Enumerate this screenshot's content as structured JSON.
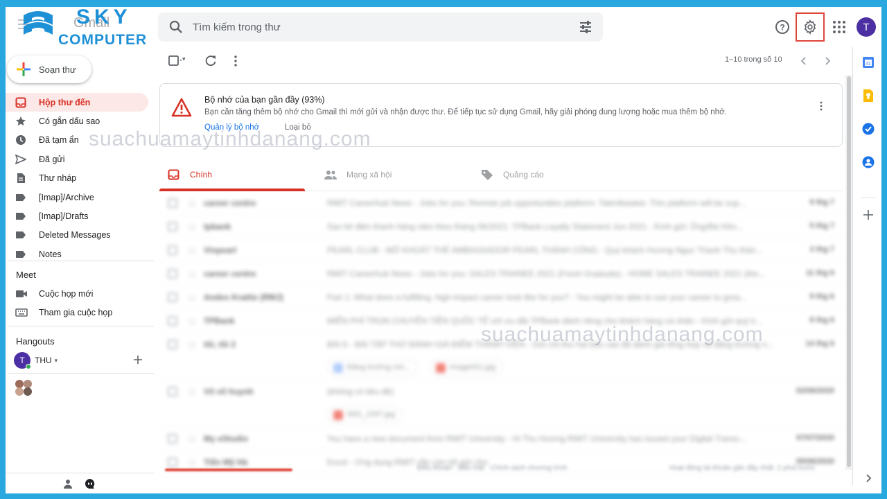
{
  "brand": {
    "logo_line1": "SKY",
    "logo_line2": "COMPUTER",
    "app_name": "Gmail"
  },
  "search": {
    "placeholder": "Tìm kiếm trong thư"
  },
  "header": {
    "avatar_initial": "T"
  },
  "compose": {
    "label": "Soạn thư"
  },
  "nav": [
    {
      "label": "Hộp thư đến",
      "icon": "inbox-icon",
      "active": true
    },
    {
      "label": "Có gắn dấu sao",
      "icon": "star-icon"
    },
    {
      "label": "Đã tạm ẩn",
      "icon": "clock-icon"
    },
    {
      "label": "Đã gửi",
      "icon": "send-icon"
    },
    {
      "label": "Thư nháp",
      "icon": "draft-icon"
    },
    {
      "label": "[Imap]/Archive",
      "icon": "label-icon"
    },
    {
      "label": "[Imap]/Drafts",
      "icon": "label-icon"
    },
    {
      "label": "Deleted Messages",
      "icon": "label-icon"
    },
    {
      "label": "Notes",
      "icon": "label-icon"
    }
  ],
  "meet": {
    "title": "Meet",
    "items": [
      {
        "label": "Cuộc họp mới",
        "icon": "video-icon"
      },
      {
        "label": "Tham gia cuộc họp",
        "icon": "keyboard-icon"
      }
    ]
  },
  "hangouts": {
    "title": "Hangouts",
    "user_name": "THU",
    "user_initial": "T"
  },
  "toolbar": {
    "pager": "1–10 trong số 10"
  },
  "alert": {
    "title": "Bộ nhớ của bạn gần đầy (93%)",
    "body": "Bạn cần tăng thêm bộ nhớ cho Gmail thì mới gửi và nhận được thư. Để tiếp tục sử dụng Gmail, hãy giải phóng dung lượng hoặc mua thêm bộ nhớ.",
    "link_manage": "Quản lý bộ nhớ",
    "link_dismiss": "Loại bỏ"
  },
  "watermark": "suachuamaytinhdanang.com",
  "tabs": [
    {
      "label": "Chính",
      "icon": "inbox-icon",
      "active": true
    },
    {
      "label": "Mạng xã hội",
      "icon": "people-icon"
    },
    {
      "label": "Quảng cáo",
      "icon": "tag-icon"
    }
  ],
  "colors": {
    "accent_red": "#d93025",
    "frame_blue": "#29a8e0",
    "link_blue": "#1a73e8"
  },
  "emails": [
    {
      "sender": "career centre",
      "subject": "RMIT Careerhub News - Jobs for you: Remote job opportunities platform: Talentbasket. This platform will be sup...",
      "date": "9 thg 7"
    },
    {
      "sender": "tpbank",
      "subject": "Sao kê điện thanh hàng năm theo tháng 06/2021: TPBank Loyalty Statement Jun 2021 - Kính gửi: Ông/Bà Hồn...",
      "date": "5 thg 7"
    },
    {
      "sender": "Vinpearl",
      "subject": "PEARL CLUB - MỞ KHOÁT THẺ AMBASSADOR PEARL THÀNH CÔNG - Quý khách Hương Ngọc Thanh Thu thân...",
      "date": "3 thg 7"
    },
    {
      "sender": "career centre",
      "subject": "RMIT Careerhub News - Jobs for you: SALES TRAINEE 2021 (Fresh Graduate) - HOME SALES TRAINEE 2021 (the...",
      "date": "11 thg 6"
    },
    {
      "sender": "Andes Krattie (RMJ)",
      "subject": "Part 1: What does a fulfilling, high-impact career look like for you? - You might be able to use your career to grea...",
      "date": "9 thg 6"
    },
    {
      "sender": "TPBank",
      "subject": "MIỄN PHÍ TRỌN CHUYỂN TIỀN QUỐC TẾ với ưu đãi TPBank dành riêng cho khách hàng cá nhân - Kính gửi quý k...",
      "date": "8 thg 6"
    },
    {
      "sender": "tôi, tôi 2",
      "subject": "BÀI 6 - BÀI TẬP THỬ ĐÁNH GIÁ ĐIỂM THÀNH VIÊN - Gửi chị thư hai báo cáo đã đánh giá tổng hợp và đăng trường n...",
      "date": "14 thg 6",
      "chips": [
        "Đăng trường nơi...",
        "image001.jpg"
      ]
    },
    {
      "sender": "Võ võ huynh",
      "subject": "(không có tiêu đề)",
      "date": "02/06/2020",
      "chips": [
        "IMG_1597.jpg"
      ]
    },
    {
      "sender": "My eStudio",
      "subject": "You have a new document from RMIT University - Hi Thu Hương RMIT University has issued your Digital Transc...",
      "date": "07/07/2020"
    },
    {
      "sender": "Tiến Mỹ Hà",
      "subject": "Excel - Ứng dụng RMIT vẫn còn tốt gửi cho",
      "date": "05/06/2020"
    }
  ],
  "footer": {
    "left": "Điều khoản · Bảo mật · Chính sách chương trình",
    "right": "Hoạt động tài khoản gần đây nhất: 2 phút trước"
  }
}
